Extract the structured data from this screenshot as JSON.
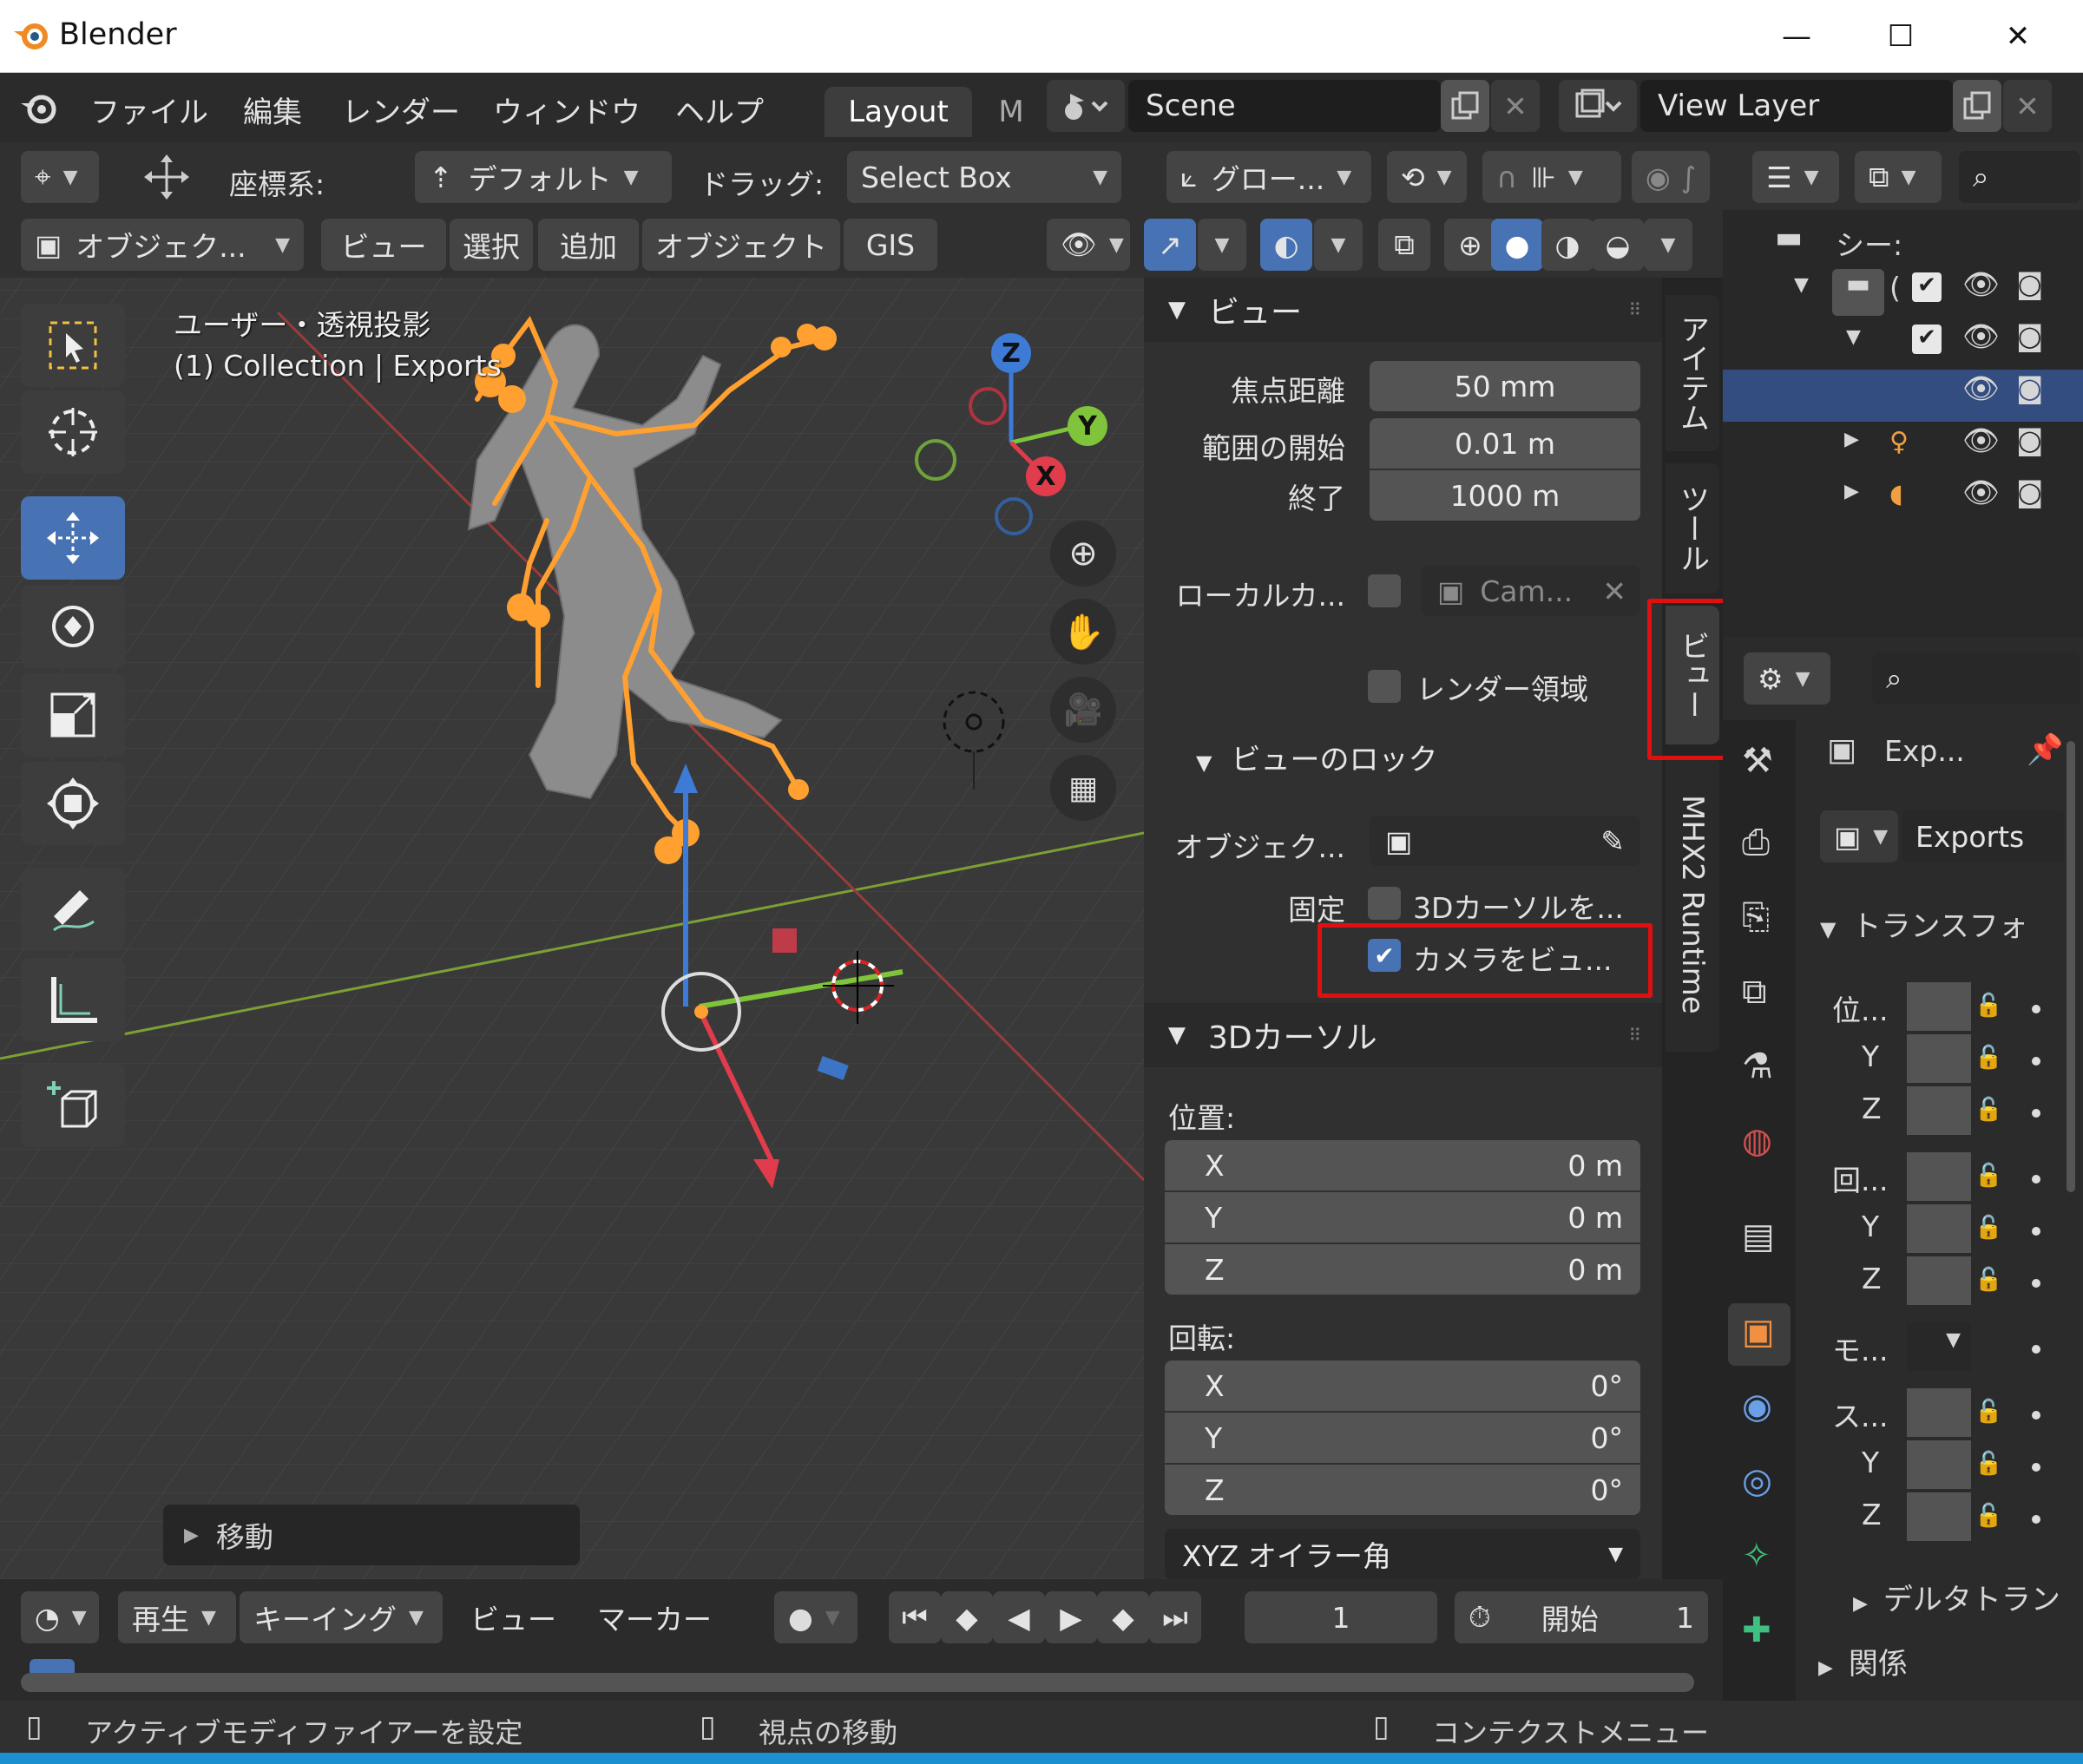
{
  "window": {
    "title": "Blender",
    "minimize": "—",
    "maximize": "☐",
    "close": "✕"
  },
  "menu": {
    "items": [
      "ファイル",
      "編集",
      "レンダー",
      "ウィンドウ",
      "ヘルプ"
    ],
    "workspace_tabs": [
      "Layout",
      "M"
    ],
    "scene": "Scene",
    "view_layer": "View Layer"
  },
  "tool_header": {
    "coord_label": "座標系:",
    "coord_value": "デフォルト",
    "drag_label": "ドラッグ:",
    "drag_value": "Select Box",
    "orientation": "グロー..."
  },
  "view_header": {
    "mode": "オブジェク...",
    "menus": [
      "ビュー",
      "選択",
      "追加",
      "オブジェクト",
      "GIS"
    ]
  },
  "viewport": {
    "view_name": "ユーザー・透視投影",
    "collection": "(1) Collection | Exports",
    "gizmo": {
      "z": "Z",
      "y": "Y",
      "x": "X"
    },
    "last_op": "移動"
  },
  "npanel": {
    "view_section": "ビュー",
    "focal_label": "焦点距離",
    "focal_value": "50 mm",
    "clip_start_label": "範囲の開始",
    "clip_start_value": "0.01 m",
    "clip_end_label": "終了",
    "clip_end_value": "1000 m",
    "local_camera_label": "ローカルカ...",
    "local_camera_value": "Cam...",
    "render_region_label": "レンダー領域",
    "view_lock_section": "ビューのロック",
    "lock_object_label": "オブジェク...",
    "lock_label": "固定",
    "lock_cursor_label": "3Dカーソルを...",
    "lock_camera_label": "カメラをビュ...",
    "cursor_section": "3Dカーソル",
    "location_label": "位置:",
    "loc_x": {
      "axis": "X",
      "value": "0 m"
    },
    "loc_y": {
      "axis": "Y",
      "value": "0 m"
    },
    "loc_z": {
      "axis": "Z",
      "value": "0 m"
    },
    "rotation_label": "回転:",
    "rot_x": {
      "axis": "X",
      "value": "0°"
    },
    "rot_y": {
      "axis": "Y",
      "value": "0°"
    },
    "rot_z": {
      "axis": "Z",
      "value": "0°"
    },
    "rotation_mode": "XYZ オイラー角"
  },
  "ntabs": [
    "アイテム",
    "ツール",
    "ビュー",
    "MHX2 Runtime"
  ],
  "outliner": {
    "scene_collection": "シー:",
    "row2": "("
  },
  "properties": {
    "object_name": "Exp...",
    "data_name": "Exports",
    "transform_section": "トランスフォ",
    "loc_label": "位...",
    "y": "Y",
    "z": "Z",
    "rot_label": "回...",
    "mode_label": "モ...",
    "scale_label": "ス...",
    "delta_section": "デルタトラン",
    "relations_section": "関係"
  },
  "timeline": {
    "menus": [
      "再生",
      "キーイング",
      "ビュー",
      "マーカー"
    ],
    "current_frame": "1",
    "start_label": "開始",
    "start_value": "1"
  },
  "status": {
    "left": "アクティブモディファイアーを設定",
    "middle": "視点の移動",
    "right": "コンテクストメニュー"
  },
  "colors": {
    "accent": "#4772b3",
    "highlight_box": "#e01010",
    "bone": "#ffa030"
  }
}
